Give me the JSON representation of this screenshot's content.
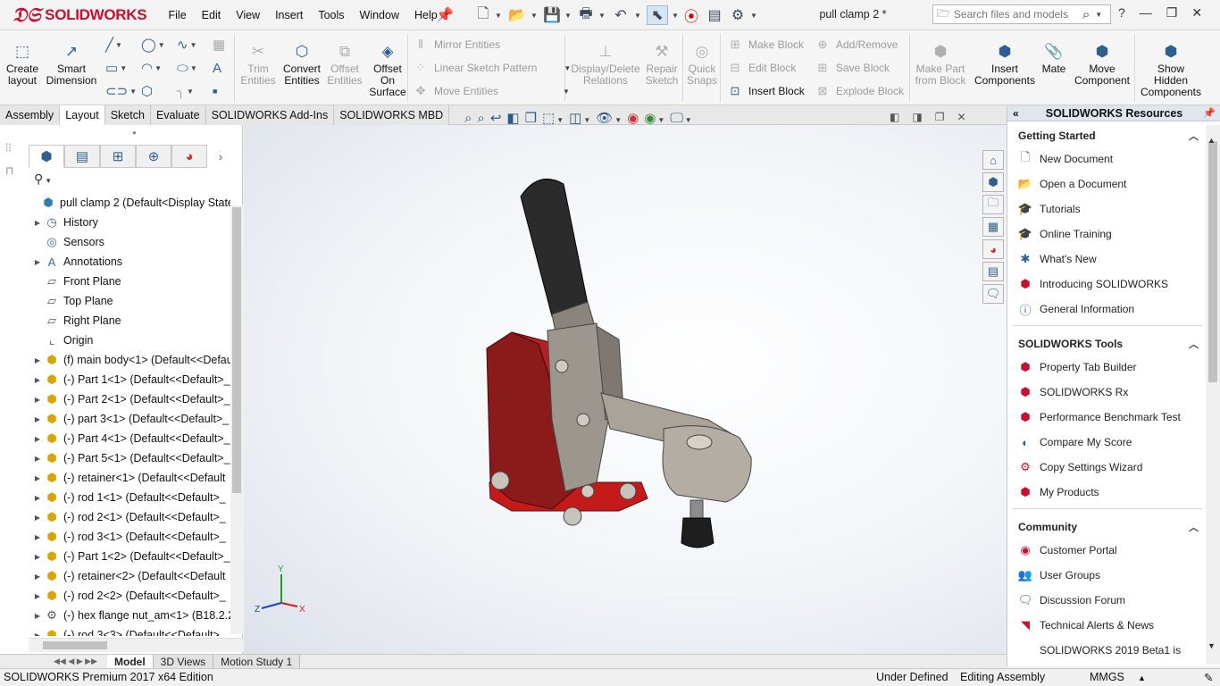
{
  "app": {
    "brand": "SOLIDWORKS",
    "doc_title": "pull clamp 2 *"
  },
  "menu": [
    "File",
    "Edit",
    "View",
    "Insert",
    "Tools",
    "Window",
    "Help"
  ],
  "search": {
    "placeholder": "Search files and models"
  },
  "command_manager": {
    "big_buttons": [
      {
        "label": "Create\nlayout",
        "enabled": true
      },
      {
        "label": "Smart\nDimension",
        "enabled": true
      },
      {
        "label": "Trim\nEntities",
        "enabled": false
      },
      {
        "label": "Convert\nEntities",
        "enabled": true
      },
      {
        "label": "Offset\nEntities",
        "enabled": false
      },
      {
        "label": "Offset\nOn\nSurface",
        "enabled": true
      },
      {
        "label": "Display/Delete\nRelations",
        "enabled": false
      },
      {
        "label": "Repair\nSketch",
        "enabled": false
      },
      {
        "label": "Quick\nSnaps",
        "enabled": false
      },
      {
        "label": "Make Part\nfrom Block",
        "enabled": false
      },
      {
        "label": "Insert\nComponents",
        "enabled": true
      },
      {
        "label": "Mate",
        "enabled": true
      },
      {
        "label": "Move\nComponent",
        "enabled": true
      },
      {
        "label": "Show\nHidden\nComponents",
        "enabled": true
      }
    ],
    "small_buttons": {
      "mirror_entities": "Mirror Entities",
      "linear_sketch_pattern": "Linear Sketch Pattern",
      "move_entities": "Move Entities",
      "make_block": "Make Block",
      "edit_block": "Edit Block",
      "insert_block": "Insert Block",
      "add_remove": "Add/Remove",
      "save_block": "Save Block",
      "explode_block": "Explode Block"
    }
  },
  "tabs": [
    "Assembly",
    "Layout",
    "Sketch",
    "Evaluate",
    "SOLIDWORKS Add-Ins",
    "SOLIDWORKS MBD"
  ],
  "active_tab": "Layout",
  "feature_tree": {
    "root": "pull clamp 2  (Default<Display State-1",
    "items": [
      {
        "label": "History",
        "icon": "history-icon",
        "expandable": true
      },
      {
        "label": "Sensors",
        "icon": "sensor-icon",
        "expandable": false
      },
      {
        "label": "Annotations",
        "icon": "annotations-icon",
        "expandable": true
      },
      {
        "label": "Front Plane",
        "icon": "plane-icon",
        "expandable": false
      },
      {
        "label": "Top Plane",
        "icon": "plane-icon",
        "expandable": false
      },
      {
        "label": "Right Plane",
        "icon": "plane-icon",
        "expandable": false
      },
      {
        "label": "Origin",
        "icon": "origin-icon",
        "expandable": false
      },
      {
        "label": "(f) main body<1> (Default<<Defau",
        "icon": "part-icon",
        "expandable": true
      },
      {
        "label": "(-) Part 1<1> (Default<<Default>_",
        "icon": "part-icon",
        "expandable": true
      },
      {
        "label": "(-) Part 2<1> (Default<<Default>_",
        "icon": "part-icon",
        "expandable": true
      },
      {
        "label": "(-) part 3<1> (Default<<Default>_",
        "icon": "part-icon",
        "expandable": true
      },
      {
        "label": "(-) Part 4<1> (Default<<Default>_",
        "icon": "part-icon",
        "expandable": true
      },
      {
        "label": "(-) Part 5<1> (Default<<Default>_",
        "icon": "part-icon",
        "expandable": true
      },
      {
        "label": "(-) retainer<1> (Default<<Default",
        "icon": "part-icon",
        "expandable": true
      },
      {
        "label": "(-) rod 1<1> (Default<<Default>_",
        "icon": "part-icon",
        "expandable": true
      },
      {
        "label": "(-) rod 2<1> (Default<<Default>_",
        "icon": "part-icon",
        "expandable": true
      },
      {
        "label": "(-) rod 3<1> (Default<<Default>_",
        "icon": "part-icon",
        "expandable": true
      },
      {
        "label": "(-) Part 1<2> (Default<<Default>_",
        "icon": "part-icon",
        "expandable": true
      },
      {
        "label": "(-) retainer<2> (Default<<Default",
        "icon": "part-icon",
        "expandable": true
      },
      {
        "label": "(-) rod 2<2> (Default<<Default>_",
        "icon": "part-icon",
        "expandable": true
      },
      {
        "label": "(-) hex flange nut_am<1> (B18.2.2",
        "icon": "nut-icon",
        "expandable": true
      },
      {
        "label": "(-) rod 3<3> (Default<<Default>_",
        "icon": "part-icon",
        "expandable": true
      }
    ]
  },
  "task_pane": {
    "title": "SOLIDWORKS Resources",
    "sections": [
      {
        "title": "Getting Started",
        "items": [
          {
            "label": "New Document",
            "icon": "new-document-icon"
          },
          {
            "label": "Open a Document",
            "icon": "open-document-icon"
          },
          {
            "label": "Tutorials",
            "icon": "graduation-cap-icon"
          },
          {
            "label": "Online Training",
            "icon": "graduation-cap-icon"
          },
          {
            "label": "What's New",
            "icon": "whats-new-icon"
          },
          {
            "label": "Introducing SOLIDWORKS",
            "icon": "solidworks-cube-icon"
          },
          {
            "label": "General Information",
            "icon": "info-icon"
          }
        ]
      },
      {
        "title": "SOLIDWORKS Tools",
        "items": [
          {
            "label": "Property Tab Builder",
            "icon": "rx-tool-icon"
          },
          {
            "label": "SOLIDWORKS Rx",
            "icon": "rx-tool-icon"
          },
          {
            "label": "Performance Benchmark Test",
            "icon": "rx-tool-icon"
          },
          {
            "label": "Compare My Score",
            "icon": "compare-icon"
          },
          {
            "label": "Copy Settings Wizard",
            "icon": "settings-wizard-icon"
          },
          {
            "label": "My Products",
            "icon": "products-icon"
          }
        ]
      },
      {
        "title": "Community",
        "items": [
          {
            "label": "Customer Portal",
            "icon": "portal-icon"
          },
          {
            "label": "User Groups",
            "icon": "users-icon"
          },
          {
            "label": "Discussion Forum",
            "icon": "forum-icon"
          },
          {
            "label": "Technical Alerts & News",
            "icon": "rss-icon"
          },
          {
            "label": "SOLIDWORKS 2019 Beta1 is",
            "icon": ""
          }
        ]
      }
    ]
  },
  "bottom_tabs": [
    "Model",
    "3D Views",
    "Motion Study 1"
  ],
  "active_bottom_tab": "Model",
  "status": {
    "edition": "SOLIDWORKS Premium 2017 x64 Edition",
    "state": "Under Defined",
    "mode": "Editing Assembly",
    "units": "MMGS"
  },
  "triad": {
    "x": "X",
    "y": "Y",
    "z": "Z"
  },
  "colors": {
    "brand": "#c8102e",
    "clamp_body": "#8b1a1a",
    "handle": "#2b2b2b",
    "link": "#9c968e"
  }
}
